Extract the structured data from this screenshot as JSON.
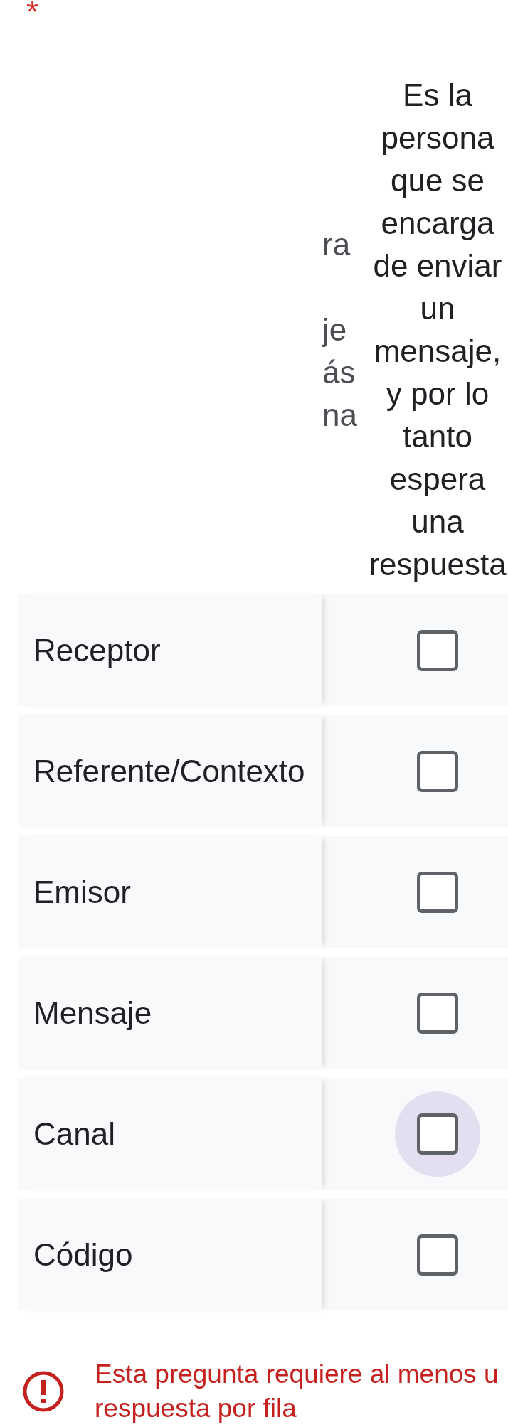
{
  "question": {
    "required_mark": "*"
  },
  "grid": {
    "column_1_fragments": [
      "ra",
      "je",
      "ás",
      "na"
    ],
    "column_2": {
      "header": "Es la persona que se encarga de enviar un mensaje, y por lo tanto espera una respuesta"
    },
    "rows": [
      {
        "label": "Receptor",
        "checked": false,
        "focused": false
      },
      {
        "label": "Referente/Contexto",
        "checked": false,
        "focused": false
      },
      {
        "label": "Emisor",
        "checked": false,
        "focused": false
      },
      {
        "label": "Mensaje",
        "checked": false,
        "focused": false
      },
      {
        "label": "Canal",
        "checked": false,
        "focused": true
      },
      {
        "label": "Código",
        "checked": false,
        "focused": false
      }
    ]
  },
  "error": {
    "message_lines": [
      "Esta pregunta requiere al menos u",
      "respuesta por fila"
    ]
  }
}
